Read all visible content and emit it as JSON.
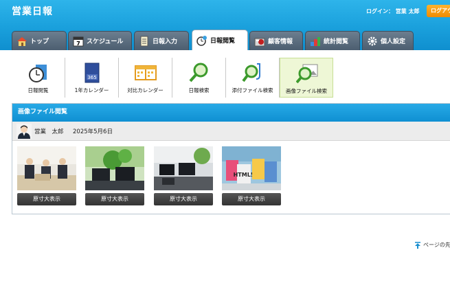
{
  "header": {
    "app_title": "営業日報",
    "login_info": "ログイン： 営業 太郎",
    "logout_label": "ログアウト"
  },
  "tabs": [
    {
      "label": "トップ",
      "icon": "home-icon"
    },
    {
      "label": "スケジュール",
      "icon": "calendar-icon"
    },
    {
      "label": "日報入力",
      "icon": "notepad-icon"
    },
    {
      "label": "日報閲覧",
      "icon": "clock-magnifier-icon",
      "active": true
    },
    {
      "label": "顧客情報",
      "icon": "customer-icon"
    },
    {
      "label": "統計閲覧",
      "icon": "statistics-icon"
    },
    {
      "label": "個人設定",
      "icon": "gear-icon"
    }
  ],
  "subnav": [
    {
      "label": "日報閲覧",
      "icon": "clock-folder-icon"
    },
    {
      "label": "1年カレンダー",
      "icon": "yearly-calendar-icon"
    },
    {
      "label": "対比カレンダー",
      "icon": "compare-calendar-icon"
    },
    {
      "label": "日報検索",
      "icon": "search-icon"
    },
    {
      "label": "添付ファイル検索",
      "icon": "attachment-search-icon"
    },
    {
      "label": "画像ファイル検索",
      "icon": "image-search-icon",
      "active": true
    }
  ],
  "panel": {
    "title": "画像ファイル閲覧",
    "user_name": "営業　太郎",
    "date": "2025年5月6日",
    "images": [
      {
        "button_label": "原寸大表示"
      },
      {
        "button_label": "原寸大表示"
      },
      {
        "button_label": "原寸大表示"
      },
      {
        "button_label": "原寸大表示"
      }
    ]
  },
  "footer": {
    "page_top_label": "ページの先頭へ"
  },
  "colors": {
    "header_blue": "#1aa0dc",
    "logout_orange": "#f08a00",
    "tab_gray": "#5a6c7e",
    "active_subnav": "#eef7d6"
  }
}
